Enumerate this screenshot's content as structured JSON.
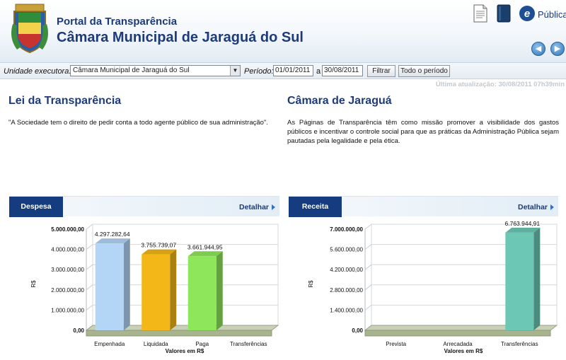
{
  "header": {
    "portal_title": "Portal da Transparência",
    "main_title": "Câmara Municipal de Jaraguá do Sul",
    "publica_label": "Pública",
    "icons": [
      "document-icon",
      "book-icon",
      "e-publica-logo-icon",
      "back-arrow-icon",
      "forward-arrow-icon"
    ]
  },
  "filter": {
    "unidade_label": "Unidade executora:",
    "unidade_value": "Câmara Municipal de Jaraguá do Sul",
    "periodo_label": "Período:",
    "date_from": "01/01/2011",
    "separator": "a",
    "date_to": "30/08/2011",
    "filtrar_label": "Filtrar",
    "todo_periodo_label": "Todo o período"
  },
  "last_update": "Última atualização: 30/08/2011 07h39min",
  "left_section": {
    "title": "Lei da Transparência",
    "text": "\"A Sociedade tem o direito de pedir conta a todo agente público de sua administração\"."
  },
  "right_section": {
    "title": "Câmara de Jaraguá",
    "text": "As Páginas de Transparência têm como missão promover a visibilidade dos gastos públicos e incentivar o controle social para que as práticas da Administração Pública sejam pautadas pela legalidade e pela ética."
  },
  "despesa_panel": {
    "tab_label": "Despesa",
    "detail_label": "Detalhar"
  },
  "receita_panel": {
    "tab_label": "Receita",
    "detail_label": "Detalhar"
  },
  "colors": {
    "brand_blue": "#143c7e",
    "title_blue": "#1d3a7a"
  },
  "chart_data": [
    {
      "type": "bar",
      "categories": [
        "Empenhada",
        "Liquidada",
        "Paga",
        "Transferências"
      ],
      "values": [
        4297282.64,
        3755739.07,
        3661944.95,
        0
      ],
      "data_labels": [
        "4.297.282,64",
        "3.755.739,07",
        "3.661.944,95",
        ""
      ],
      "bar_colors": [
        "#b3d6f7",
        "#f3b817",
        "#8ee75a",
        "#cccccc"
      ],
      "ylabel": "R$",
      "xlabel": "Valores em R$",
      "ylim": [
        0,
        5000000
      ],
      "yticks": [
        0,
        1000000,
        2000000,
        3000000,
        4000000,
        5000000
      ],
      "ytick_labels": [
        "0,00",
        "1.000.000,00",
        "2.000.000,00",
        "3.000.000,00",
        "4.000.000,00",
        "5.000.000,00"
      ],
      "grid": true
    },
    {
      "type": "bar",
      "categories": [
        "Prevista",
        "Arrecadada",
        "Transferências"
      ],
      "values": [
        0,
        0,
        6763944.91
      ],
      "data_labels": [
        "",
        "",
        "6.763.944,91"
      ],
      "bar_colors": [
        "#cccccc",
        "#cccccc",
        "#6cc8b4"
      ],
      "ylabel": "R$",
      "xlabel": "Valores em R$",
      "ylim": [
        0,
        7000000
      ],
      "yticks": [
        0,
        1400000,
        2800000,
        4200000,
        5600000,
        7000000
      ],
      "ytick_labels": [
        "0,00",
        "1.400.000,00",
        "2.800.000,00",
        "4.200.000,00",
        "5.600.000,00",
        "7.000.000,00"
      ],
      "grid": true
    }
  ]
}
